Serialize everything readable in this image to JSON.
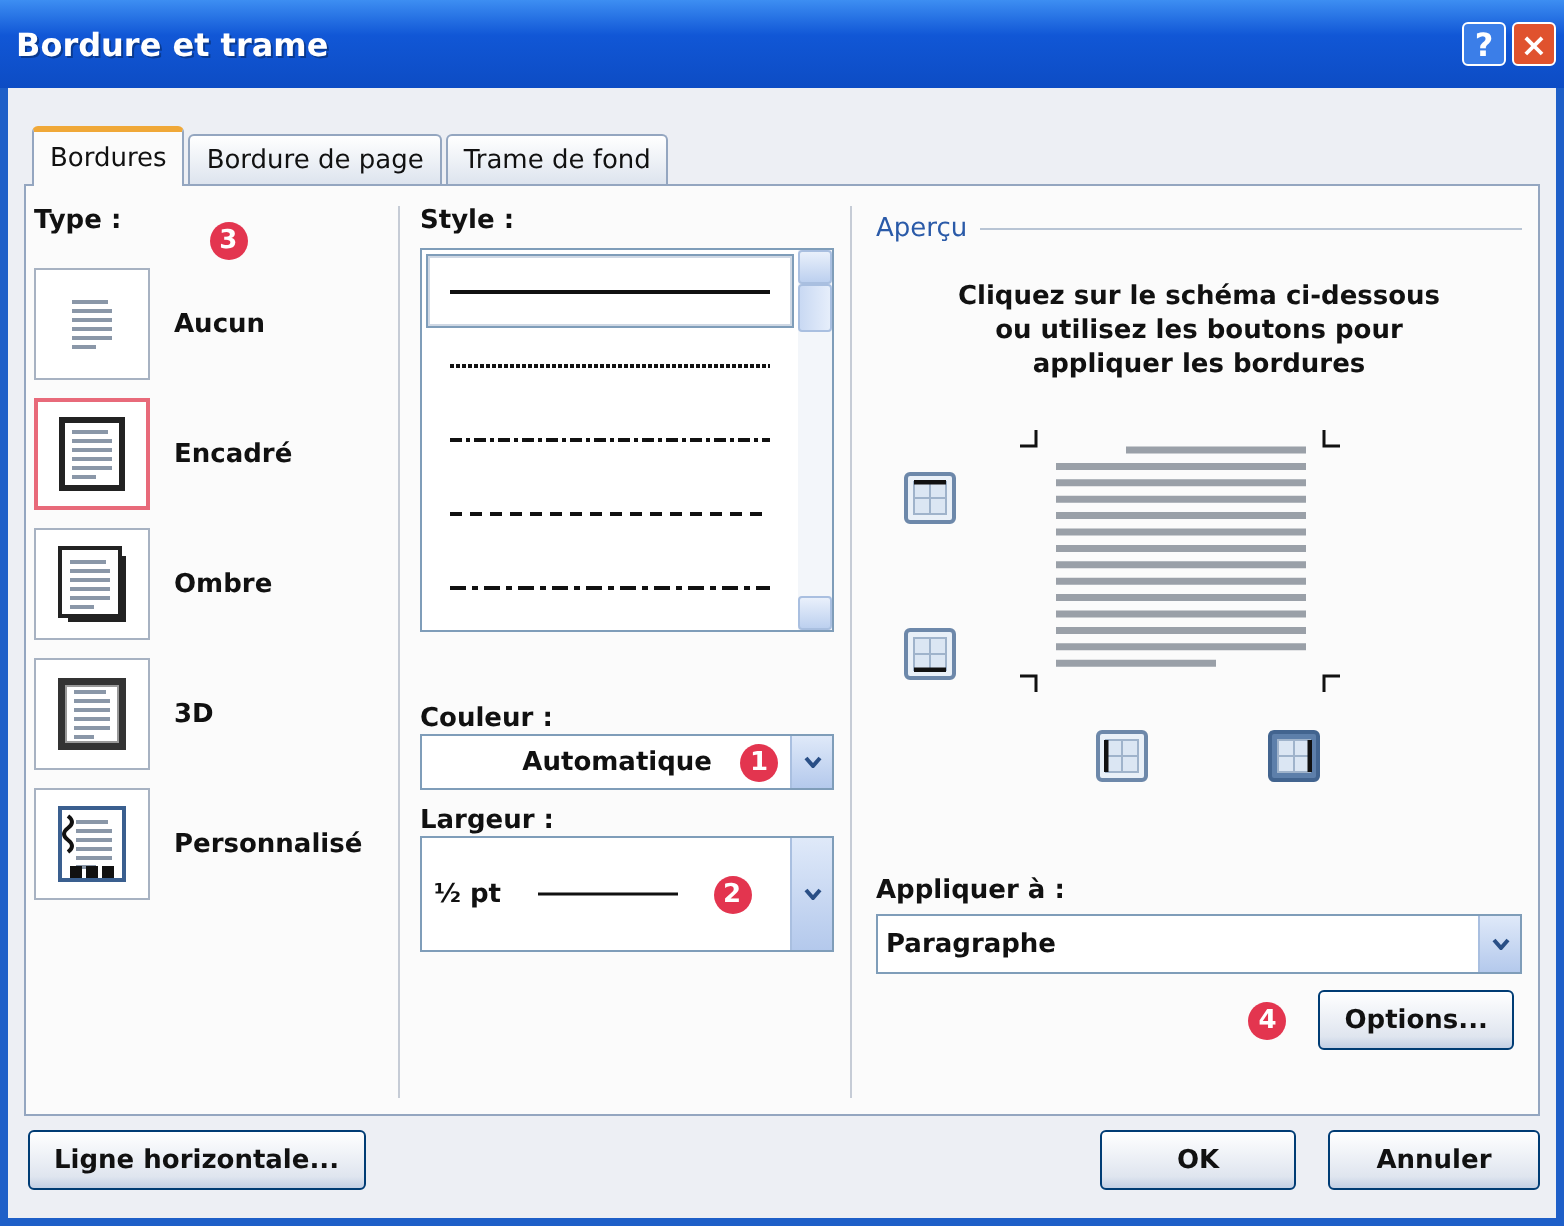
{
  "window": {
    "title": "Bordure et trame"
  },
  "title_buttons": [
    {
      "kind": "help",
      "label": "?"
    },
    {
      "kind": "close",
      "label": "×"
    }
  ],
  "tabs": [
    {
      "label": "Bordures",
      "selected": true
    },
    {
      "label": "Bordure de page",
      "selected": false
    },
    {
      "label": "Trame de fond",
      "selected": false
    }
  ],
  "type_panel": {
    "label": "Type :",
    "callout": "3",
    "options": [
      {
        "kind": "none",
        "label": "Aucun",
        "selected": false
      },
      {
        "kind": "box",
        "label": "Encadré",
        "selected": true
      },
      {
        "kind": "shadow",
        "label": "Ombre",
        "selected": false
      },
      {
        "kind": "threed",
        "label": "3D",
        "selected": false
      },
      {
        "kind": "custom",
        "label": "Personnalisé",
        "selected": false
      }
    ]
  },
  "style_panel": {
    "label": "Style :",
    "styles": [
      {
        "kind": "solid",
        "selected": true
      },
      {
        "kind": "dotted",
        "selected": false
      },
      {
        "kind": "dash-dot",
        "selected": false
      },
      {
        "kind": "dashed",
        "selected": false
      },
      {
        "kind": "long-dash",
        "selected": false
      }
    ],
    "color": {
      "label": "Couleur :",
      "value": "Automatique",
      "callout": "1"
    },
    "width": {
      "label": "Largeur :",
      "value": "½ pt",
      "callout": "2"
    }
  },
  "preview": {
    "label": "Aperçu",
    "instructions": "Cliquez sur le schéma ci-dessous ou utilisez les boutons pour appliquer les bordures",
    "border_buttons": [
      {
        "kind": "top",
        "on": false
      },
      {
        "kind": "bottom",
        "on": false
      },
      {
        "kind": "left",
        "on": false
      },
      {
        "kind": "right",
        "on": true
      }
    ],
    "apply_to": {
      "label": "Appliquer à :",
      "value": "Paragraphe"
    },
    "options_button": "Options...",
    "callout": "4"
  },
  "footer_buttons": [
    {
      "kind": "left",
      "label": "Ligne horizontale..."
    },
    {
      "kind": "right",
      "label": "OK"
    },
    {
      "kind": "right",
      "label": "Annuler"
    }
  ]
}
